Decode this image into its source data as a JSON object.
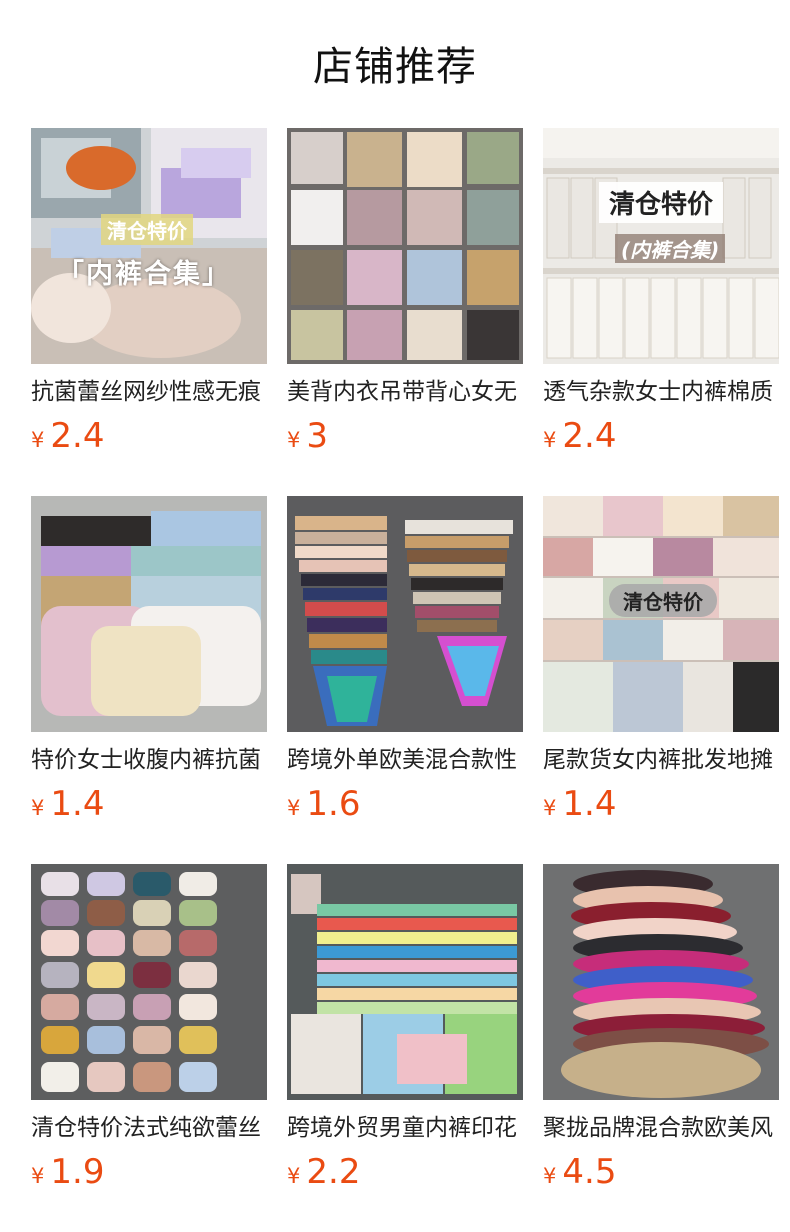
{
  "section_title": "店铺推荐",
  "currency_symbol": "¥",
  "products": [
    {
      "name": "抗菌蕾丝网纱性感无痕",
      "price": "2.4",
      "overlay_top": "清仓特价",
      "overlay_main": "「内裤合集」"
    },
    {
      "name": "美背内衣吊带背心女无",
      "price": "3"
    },
    {
      "name": "透气杂款女士内裤棉质",
      "price": "2.4",
      "overlay_top": "清仓特价",
      "overlay_main": "(内裤合集)"
    },
    {
      "name": "特价女士收腹内裤抗菌",
      "price": "1.4"
    },
    {
      "name": "跨境外单欧美混合款性",
      "price": "1.6"
    },
    {
      "name": "尾款货女内裤批发地摊",
      "price": "1.4",
      "overlay_top": "清仓特价"
    },
    {
      "name": "清仓特价法式纯欲蕾丝",
      "price": "1.9"
    },
    {
      "name": "跨境外贸男童内裤印花",
      "price": "2.2"
    },
    {
      "name": "聚拢品牌混合款欧美风",
      "price": "4.5"
    }
  ]
}
